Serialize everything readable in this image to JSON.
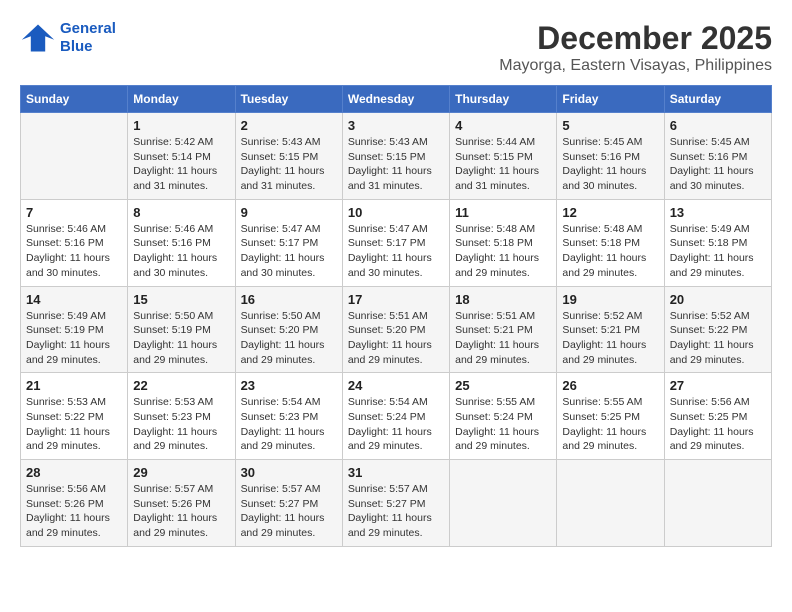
{
  "header": {
    "logo_line1": "General",
    "logo_line2": "Blue",
    "month": "December 2025",
    "location": "Mayorga, Eastern Visayas, Philippines"
  },
  "weekdays": [
    "Sunday",
    "Monday",
    "Tuesday",
    "Wednesday",
    "Thursday",
    "Friday",
    "Saturday"
  ],
  "weeks": [
    [
      {
        "day": "",
        "info": ""
      },
      {
        "day": "1",
        "info": "Sunrise: 5:42 AM\nSunset: 5:14 PM\nDaylight: 11 hours\nand 31 minutes."
      },
      {
        "day": "2",
        "info": "Sunrise: 5:43 AM\nSunset: 5:15 PM\nDaylight: 11 hours\nand 31 minutes."
      },
      {
        "day": "3",
        "info": "Sunrise: 5:43 AM\nSunset: 5:15 PM\nDaylight: 11 hours\nand 31 minutes."
      },
      {
        "day": "4",
        "info": "Sunrise: 5:44 AM\nSunset: 5:15 PM\nDaylight: 11 hours\nand 31 minutes."
      },
      {
        "day": "5",
        "info": "Sunrise: 5:45 AM\nSunset: 5:16 PM\nDaylight: 11 hours\nand 30 minutes."
      },
      {
        "day": "6",
        "info": "Sunrise: 5:45 AM\nSunset: 5:16 PM\nDaylight: 11 hours\nand 30 minutes."
      }
    ],
    [
      {
        "day": "7",
        "info": "Sunrise: 5:46 AM\nSunset: 5:16 PM\nDaylight: 11 hours\nand 30 minutes."
      },
      {
        "day": "8",
        "info": "Sunrise: 5:46 AM\nSunset: 5:16 PM\nDaylight: 11 hours\nand 30 minutes."
      },
      {
        "day": "9",
        "info": "Sunrise: 5:47 AM\nSunset: 5:17 PM\nDaylight: 11 hours\nand 30 minutes."
      },
      {
        "day": "10",
        "info": "Sunrise: 5:47 AM\nSunset: 5:17 PM\nDaylight: 11 hours\nand 30 minutes."
      },
      {
        "day": "11",
        "info": "Sunrise: 5:48 AM\nSunset: 5:18 PM\nDaylight: 11 hours\nand 29 minutes."
      },
      {
        "day": "12",
        "info": "Sunrise: 5:48 AM\nSunset: 5:18 PM\nDaylight: 11 hours\nand 29 minutes."
      },
      {
        "day": "13",
        "info": "Sunrise: 5:49 AM\nSunset: 5:18 PM\nDaylight: 11 hours\nand 29 minutes."
      }
    ],
    [
      {
        "day": "14",
        "info": "Sunrise: 5:49 AM\nSunset: 5:19 PM\nDaylight: 11 hours\nand 29 minutes."
      },
      {
        "day": "15",
        "info": "Sunrise: 5:50 AM\nSunset: 5:19 PM\nDaylight: 11 hours\nand 29 minutes."
      },
      {
        "day": "16",
        "info": "Sunrise: 5:50 AM\nSunset: 5:20 PM\nDaylight: 11 hours\nand 29 minutes."
      },
      {
        "day": "17",
        "info": "Sunrise: 5:51 AM\nSunset: 5:20 PM\nDaylight: 11 hours\nand 29 minutes."
      },
      {
        "day": "18",
        "info": "Sunrise: 5:51 AM\nSunset: 5:21 PM\nDaylight: 11 hours\nand 29 minutes."
      },
      {
        "day": "19",
        "info": "Sunrise: 5:52 AM\nSunset: 5:21 PM\nDaylight: 11 hours\nand 29 minutes."
      },
      {
        "day": "20",
        "info": "Sunrise: 5:52 AM\nSunset: 5:22 PM\nDaylight: 11 hours\nand 29 minutes."
      }
    ],
    [
      {
        "day": "21",
        "info": "Sunrise: 5:53 AM\nSunset: 5:22 PM\nDaylight: 11 hours\nand 29 minutes."
      },
      {
        "day": "22",
        "info": "Sunrise: 5:53 AM\nSunset: 5:23 PM\nDaylight: 11 hours\nand 29 minutes."
      },
      {
        "day": "23",
        "info": "Sunrise: 5:54 AM\nSunset: 5:23 PM\nDaylight: 11 hours\nand 29 minutes."
      },
      {
        "day": "24",
        "info": "Sunrise: 5:54 AM\nSunset: 5:24 PM\nDaylight: 11 hours\nand 29 minutes."
      },
      {
        "day": "25",
        "info": "Sunrise: 5:55 AM\nSunset: 5:24 PM\nDaylight: 11 hours\nand 29 minutes."
      },
      {
        "day": "26",
        "info": "Sunrise: 5:55 AM\nSunset: 5:25 PM\nDaylight: 11 hours\nand 29 minutes."
      },
      {
        "day": "27",
        "info": "Sunrise: 5:56 AM\nSunset: 5:25 PM\nDaylight: 11 hours\nand 29 minutes."
      }
    ],
    [
      {
        "day": "28",
        "info": "Sunrise: 5:56 AM\nSunset: 5:26 PM\nDaylight: 11 hours\nand 29 minutes."
      },
      {
        "day": "29",
        "info": "Sunrise: 5:57 AM\nSunset: 5:26 PM\nDaylight: 11 hours\nand 29 minutes."
      },
      {
        "day": "30",
        "info": "Sunrise: 5:57 AM\nSunset: 5:27 PM\nDaylight: 11 hours\nand 29 minutes."
      },
      {
        "day": "31",
        "info": "Sunrise: 5:57 AM\nSunset: 5:27 PM\nDaylight: 11 hours\nand 29 minutes."
      },
      {
        "day": "",
        "info": ""
      },
      {
        "day": "",
        "info": ""
      },
      {
        "day": "",
        "info": ""
      }
    ]
  ]
}
